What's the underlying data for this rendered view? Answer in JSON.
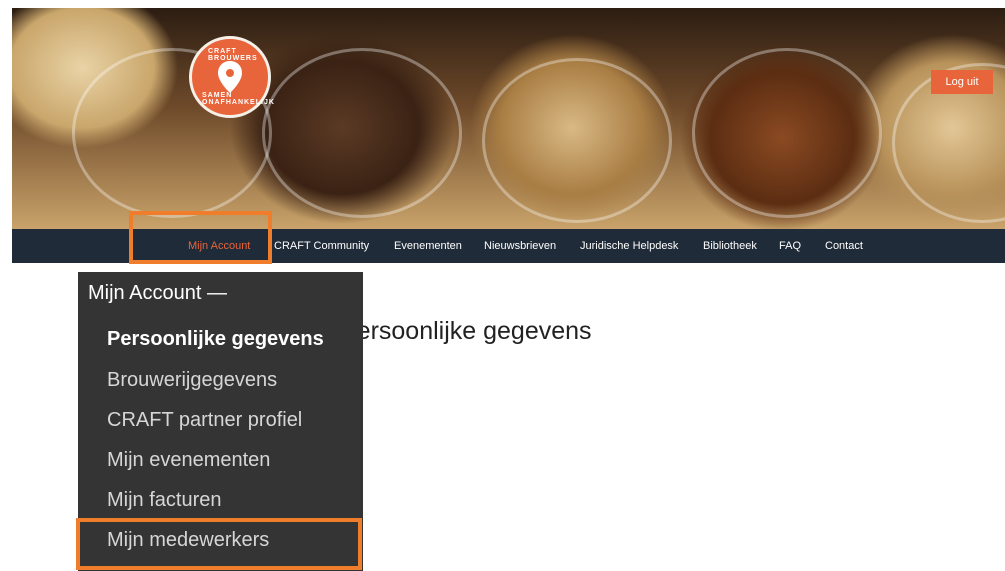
{
  "hero": {
    "logo_text_top": "CRAFT BROUWERS",
    "logo_text_bottom": "SAMEN ONAFHANKELIJK",
    "logout_label": "Log uit"
  },
  "nav": {
    "items": [
      {
        "label": "Mijn Account",
        "active": true
      },
      {
        "label": "CRAFT Community"
      },
      {
        "label": "Evenementen"
      },
      {
        "label": "Nieuwsbrieven"
      },
      {
        "label": "Juridische Helpdesk"
      },
      {
        "label": "Bibliotheek"
      },
      {
        "label": "FAQ"
      },
      {
        "label": "Contact"
      }
    ]
  },
  "dropdown": {
    "header": "Mijn Account  —",
    "items": [
      {
        "label": "Persoonlijke gegevens",
        "current": true
      },
      {
        "label": "Brouwerijgegevens"
      },
      {
        "label": "CRAFT partner profiel"
      },
      {
        "label": "Mijn evenementen"
      },
      {
        "label": "Mijn facturen"
      },
      {
        "label": "Mijn medewerkers"
      }
    ]
  },
  "page": {
    "title": "Persoonlijke gegevens"
  },
  "colors": {
    "accent": "#e8643a",
    "nav_bg": "#1f2b38",
    "dropdown_bg": "#343434",
    "highlight": "#ef7d2c"
  }
}
